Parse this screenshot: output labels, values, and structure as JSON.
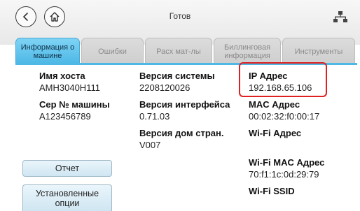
{
  "header": {
    "status": "Готов",
    "back_icon": "back-arrow-icon",
    "home_icon": "home-icon",
    "network_icon": "network-icon"
  },
  "tabs": [
    {
      "label": "Информация о машине",
      "active": true
    },
    {
      "label": "Ошибки",
      "active": false
    },
    {
      "label": "Расх мат-лы",
      "active": false
    },
    {
      "label": "Биллинговая информация",
      "active": false
    },
    {
      "label": "Инструменты",
      "active": false
    }
  ],
  "info": {
    "host_name": {
      "label": "Имя хоста",
      "value": "AMH3040H111"
    },
    "serial": {
      "label": "Сер № машины",
      "value": "A123456789"
    },
    "system_version": {
      "label": "Версия системы",
      "value": "2208120026"
    },
    "interface_version": {
      "label": "Версия интерфейса",
      "value": "0.71.03"
    },
    "home_page_version": {
      "label": "Версия дом стран.",
      "value": "V007"
    },
    "ip_address": {
      "label": "IP Адрес",
      "value": "192.168.65.106"
    },
    "mac_address": {
      "label": "MAC Адрес",
      "value": "00:02:32:f0:00:17"
    },
    "wifi_address": {
      "label": "Wi-Fi Адрес",
      "value": ""
    },
    "wifi_mac_address": {
      "label": "Wi-Fi MAC Адрес",
      "value": "70:f1:1c:0d:29:79"
    },
    "wifi_ssid": {
      "label": "Wi-Fi SSID",
      "value": ""
    }
  },
  "buttons": {
    "report": "Отчет",
    "installed_options": "Установленные опции"
  },
  "colors": {
    "accent": "#4fb9e6",
    "highlight": "#e02020"
  }
}
